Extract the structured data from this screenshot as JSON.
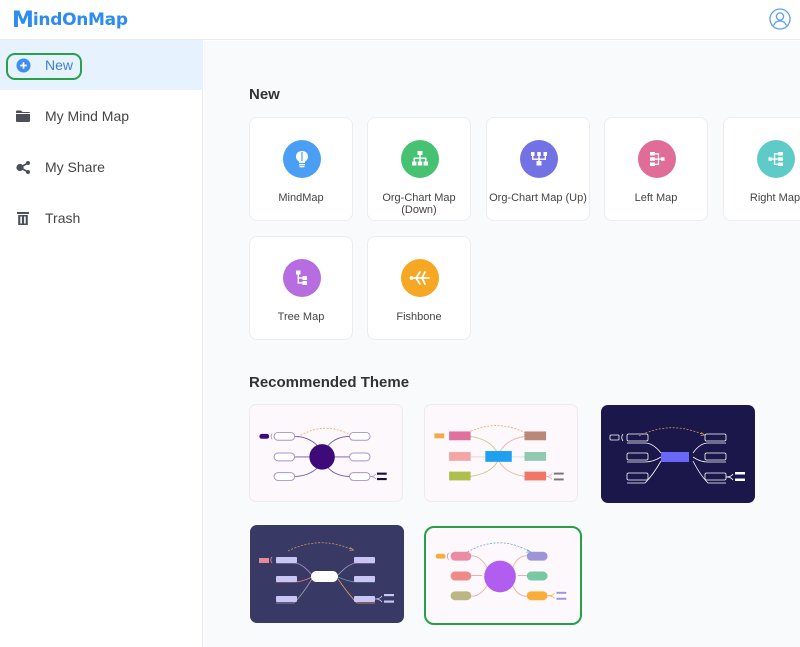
{
  "app": {
    "logo_m": "M",
    "logo_text": "indOnMap"
  },
  "sidebar": {
    "items": [
      {
        "label": "New",
        "icon": "plus-circle-icon",
        "active": true
      },
      {
        "label": "My Mind Map",
        "icon": "folder-icon"
      },
      {
        "label": "My Share",
        "icon": "share-icon"
      },
      {
        "label": "Trash",
        "icon": "trash-icon"
      }
    ]
  },
  "main": {
    "new_section_title": "New",
    "templates": [
      {
        "label": "MindMap",
        "icon": "lightbulb-icon",
        "color": "#4a9ff5"
      },
      {
        "label": "Org-Chart Map (Down)",
        "icon": "org-chart-down-icon",
        "color": "#47c273"
      },
      {
        "label": "Org-Chart Map (Up)",
        "icon": "org-chart-up-icon",
        "color": "#7272e4"
      },
      {
        "label": "Left Map",
        "icon": "left-map-icon",
        "color": "#df6d98"
      },
      {
        "label": "Right Map",
        "icon": "right-map-icon",
        "color": "#5fcbc9"
      },
      {
        "label": "Tree Map",
        "icon": "tree-map-icon",
        "color": "#b66ddf"
      },
      {
        "label": "Fishbone",
        "icon": "fishbone-icon",
        "color": "#f6a723"
      }
    ],
    "theme_section_title": "Recommended Theme",
    "themes": [
      {
        "name": "purple-outline",
        "background": "#fdf8fc",
        "selected": false
      },
      {
        "name": "colorful-rect",
        "background": "#fdf8fc",
        "selected": false
      },
      {
        "name": "dark-navy",
        "background": "#1b174b",
        "selected": false
      },
      {
        "name": "dark-slate",
        "background": "#383a65",
        "selected": false
      },
      {
        "name": "pastel-bubble",
        "background": "#fdf8fc",
        "selected": true
      }
    ]
  },
  "colors": {
    "accent": "#2d8cf0",
    "selection_outline": "#27a048",
    "active_item_bg": "#e6f2fd"
  }
}
